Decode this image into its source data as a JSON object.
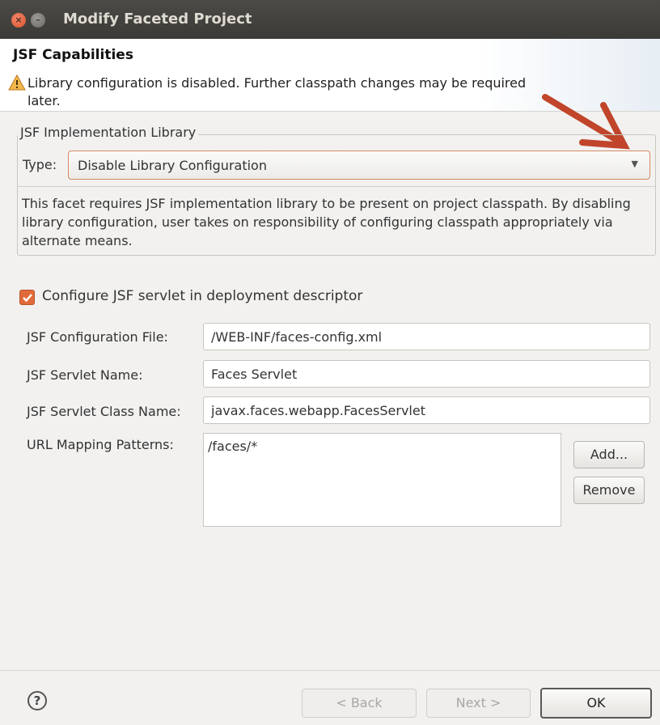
{
  "window": {
    "title": "Modify Faceted Project",
    "close_glyph": "×",
    "min_glyph": "–"
  },
  "header": {
    "title": "JSF Capabilities",
    "warning": "Library configuration is disabled. Further classpath changes may be required later."
  },
  "implementation_group": {
    "legend": "JSF Implementation Library",
    "type_label": "Type:",
    "type_value": "Disable Library Configuration",
    "description": "This facet requires JSF implementation library to be present on project classpath. By disabling library configuration, user takes on responsibility of configuring classpath appropriately via alternate means."
  },
  "servlet": {
    "checkbox_label": "Configure JSF servlet in deployment descriptor",
    "checked": true,
    "config_file_label": "JSF Configuration File:",
    "config_file_value": "/WEB-INF/faces-config.xml",
    "servlet_name_label": "JSF Servlet Name:",
    "servlet_name_value": "Faces Servlet",
    "servlet_class_label": "JSF Servlet Class Name:",
    "servlet_class_value": "javax.faces.webapp.FacesServlet",
    "url_mapping_label": "URL Mapping Patterns:",
    "url_patterns": [
      "/faces/*"
    ],
    "add_label": "Add...",
    "remove_label": "Remove"
  },
  "footer": {
    "help_glyph": "?",
    "back_label": "< Back",
    "next_label": "Next >",
    "ok_label": "OK"
  },
  "colors": {
    "accent": "#e16a3a",
    "annotation_arrow": "#c0452a",
    "titlebar": "#3c3b37"
  }
}
